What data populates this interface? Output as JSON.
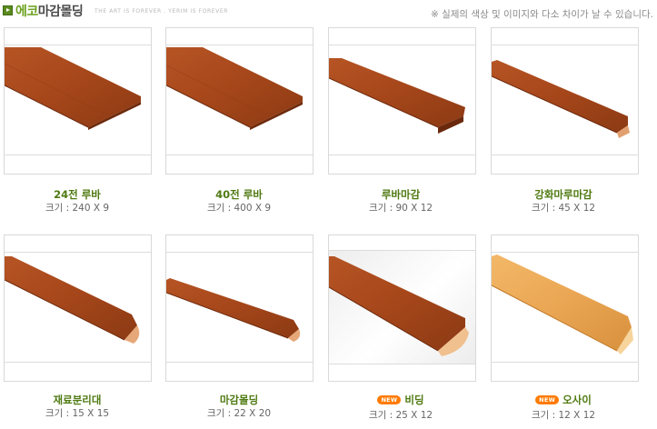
{
  "header": {
    "title_part1": "에코",
    "title_part2": "마감몰딩",
    "tagline": "THE ART IS FOREVER . YERIM IS FOREVER",
    "notice": "※ 실제의 색상 및 이미지와 다소 차이가 날 수 있습니다."
  },
  "products": [
    {
      "name": "24전 루바",
      "size": "크기 : 240 X 9",
      "badge": ""
    },
    {
      "name": "40전 루바",
      "size": "크기 : 400 X 9",
      "badge": ""
    },
    {
      "name": "루바마감",
      "size": "크기 : 90 X 12",
      "badge": ""
    },
    {
      "name": "강화마루마감",
      "size": "크기 : 45 X 12",
      "badge": ""
    },
    {
      "name": "재료분리대",
      "size": "크기 : 15 X 15",
      "badge": ""
    },
    {
      "name": "마감몰딩",
      "size": "크기 : 22 X 20",
      "badge": ""
    },
    {
      "name": "비딩",
      "size": "크기 : 25 X 12",
      "badge": "NEW"
    },
    {
      "name": "오사이",
      "size": "크기 : 12 X 12",
      "badge": "NEW"
    }
  ],
  "colors": {
    "wood_dark": "#8a3210",
    "wood_mid": "#a8481c",
    "wood_light": "#e8a452",
    "accent_green": "#4f7a12",
    "badge_orange": "#ff7b00"
  }
}
